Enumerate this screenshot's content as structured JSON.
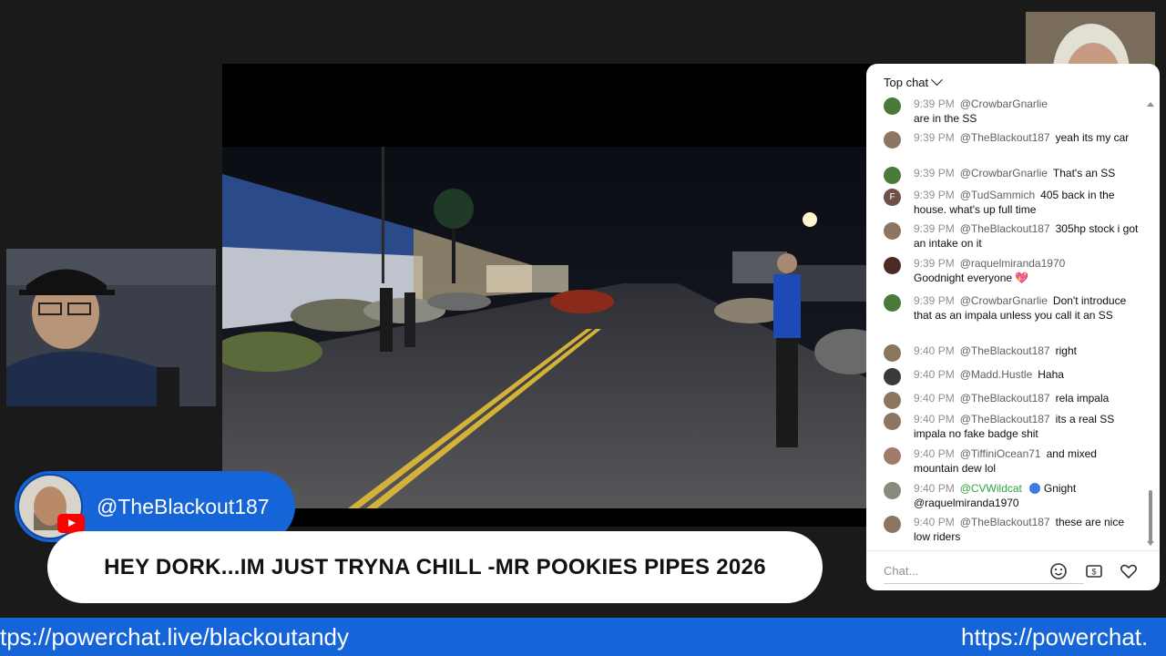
{
  "chat": {
    "header_label": "Top chat",
    "input_placeholder": "Chat...",
    "messages": [
      {
        "time": "9:39 PM",
        "author": "@CrowbarGnarlie",
        "text": "are in the SS",
        "avatar_color": "#4a7a3a"
      },
      {
        "time": "9:39 PM",
        "author": "@TheBlackout187",
        "text": "yeah its my car",
        "avatar_color": "#8c7561"
      },
      {
        "time": "9:39 PM",
        "author": "@CrowbarGnarlie",
        "text": "That's an SS",
        "avatar_color": "#4a7a3a"
      },
      {
        "time": "9:39 PM",
        "author": "@TudSammich",
        "text": "405 back in the house. what's up full time",
        "avatar_color": "#6d5048",
        "avatar_letter": "F"
      },
      {
        "time": "9:39 PM",
        "author": "@TheBlackout187",
        "text": "305hp stock i got an intake on it",
        "avatar_color": "#8c7561"
      },
      {
        "time": "9:39 PM",
        "author": "@raquelmiranda1970",
        "text": "Goodnight everyone 💖",
        "avatar_color": "#4a2a22"
      },
      {
        "time": "9:39 PM",
        "author": "@CrowbarGnarlie",
        "text": "Don't introduce that as an impala unless you call it an SS",
        "avatar_color": "#4a7a3a"
      },
      {
        "time": "9:40 PM",
        "author": "@TheBlackout187",
        "text": "right",
        "avatar_color": "#8c7561"
      },
      {
        "time": "9:40 PM",
        "author": "@Madd.Hustle",
        "text": "Haha",
        "avatar_color": "#3a3a3a"
      },
      {
        "time": "9:40 PM",
        "author": "@TheBlackout187",
        "text": "rela impala",
        "avatar_color": "#8c7561"
      },
      {
        "time": "9:40 PM",
        "author": "@TheBlackout187",
        "text": "its a real SS impala no fake badge shit",
        "avatar_color": "#8c7561"
      },
      {
        "time": "9:40 PM",
        "author": "@TiffiniOcean71",
        "text": "and mixed mountain dew lol",
        "avatar_color": "#a07a6a"
      },
      {
        "time": "9:40 PM",
        "author": "@CVWildcat",
        "text": "Gnight @raquelmiranda1970",
        "avatar_color": "#8a8a7a",
        "moderator": true
      },
      {
        "time": "9:40 PM",
        "author": "@TheBlackout187",
        "text": "these are nice low riders",
        "avatar_color": "#8c7561"
      }
    ]
  },
  "overlay": {
    "handle": "@TheBlackout187",
    "title": "HEY DORK...IM JUST TRYNA CHILL -MR POOKIES PIPES 2026",
    "ticker_left": "tps://powerchat.live/blackoutandy",
    "ticker_right": "https://powerchat."
  },
  "colors": {
    "brand_blue": "#1565d8",
    "moderator_green": "#2ba640",
    "youtube_red": "#ff0000"
  },
  "icons": [
    "chevron-down-icon",
    "emoji-icon",
    "super-chat-icon",
    "heart-icon",
    "youtube-logo-icon",
    "verified-badge-icon"
  ]
}
